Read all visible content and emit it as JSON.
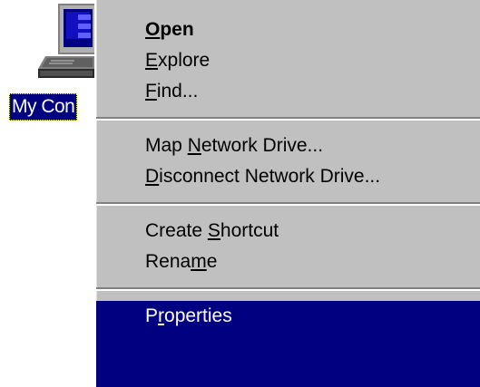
{
  "desktop": {
    "icon_name": "computer-icon",
    "label": "My Con"
  },
  "context_menu": {
    "items": [
      {
        "id": "open",
        "label": "Open",
        "access_key_index": 0,
        "default": true
      },
      {
        "id": "explore",
        "label": "Explore",
        "access_key_index": 0
      },
      {
        "id": "find",
        "label": "Find...",
        "access_key_index": 0
      },
      {
        "separator": true
      },
      {
        "id": "map-network-drive",
        "label": "Map Network Drive...",
        "access_key_index": 4
      },
      {
        "id": "disconnect-network-drive",
        "label": "Disconnect Network Drive...",
        "access_key_index": 0
      },
      {
        "separator": true
      },
      {
        "id": "create-shortcut",
        "label": "Create Shortcut",
        "access_key_index": 7
      },
      {
        "id": "rename",
        "label": "Rename",
        "access_key_index": 4
      },
      {
        "separator": true
      },
      {
        "id": "properties",
        "label": "Properties",
        "access_key_index": 1,
        "selected": true
      }
    ]
  },
  "colors": {
    "menu_background": "#c0c0c0",
    "selection_background": "#000080",
    "selection_text": "#ffffff",
    "desktop_background": "#ffffff"
  }
}
